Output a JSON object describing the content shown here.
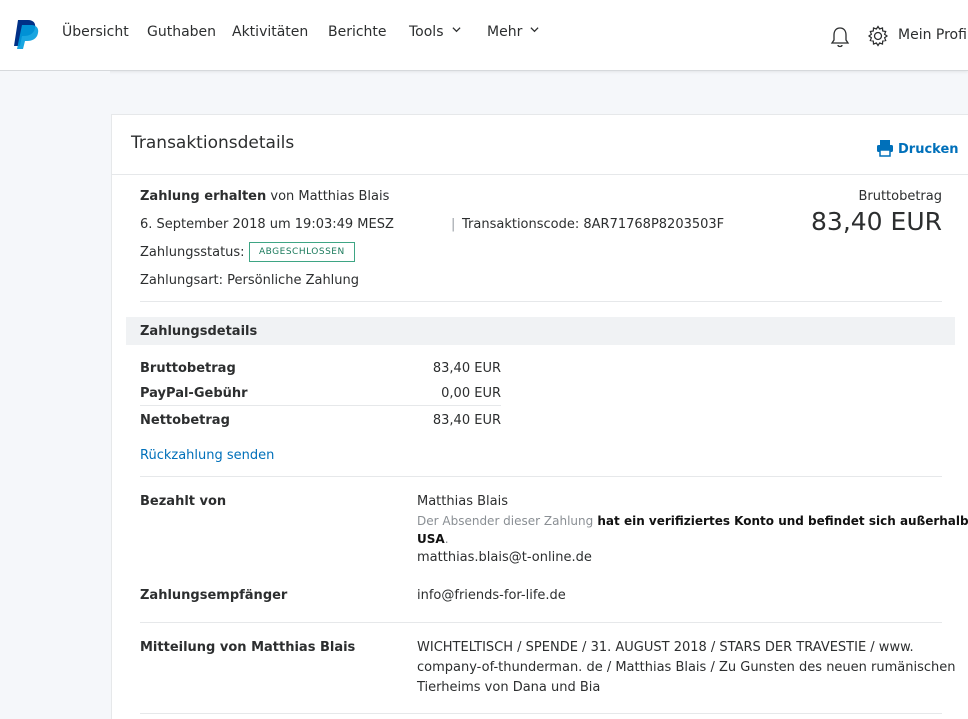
{
  "nav": {
    "items": [
      "Übersicht",
      "Guthaben",
      "Aktivitäten",
      "Berichte",
      "Tools",
      "Mehr"
    ],
    "profile": "Mein Profil"
  },
  "card": {
    "title": "Transaktionsdetails",
    "print": "Drucken"
  },
  "summary": {
    "received_label": "Zahlung erhalten",
    "from_text": "von Matthias Blais",
    "datetime": "6. September 2018 um 19:03:49 MESZ",
    "txn_code": "Transaktionscode: 8AR71768P8203503F",
    "status_label": "Zahlungsstatus:",
    "status_badge": "ABGESCHLOSSEN",
    "payment_type": "Zahlungsart: Persönliche Zahlung",
    "gross_label": "Bruttobetrag",
    "gross_amount": "83,40 EUR"
  },
  "details": {
    "heading": "Zahlungsdetails",
    "rows": [
      {
        "label": "Bruttobetrag",
        "value": "83,40 EUR"
      },
      {
        "label": "PayPal-Gebühr",
        "value": "0,00 EUR"
      },
      {
        "label": "Nettobetrag",
        "value": "83,40 EUR"
      }
    ],
    "refund_link": "Rückzahlung senden"
  },
  "payer": {
    "label": "Bezahlt von",
    "name": "Matthias Blais",
    "note_muted": "Der Absender dieser Zahlung",
    "note_bold_1": "hat ein verifiziertes Konto und befindet sich außerhalb der",
    "note_bold_2": "USA",
    "email": "matthias.blais@t-online.de"
  },
  "recipient": {
    "label": "Zahlungsempfänger",
    "email": "info@friends-for-life.de"
  },
  "message": {
    "label": "Mitteilung von Matthias Blais",
    "line1": "WICHTELTISCH / SPENDE / 31. AUGUST 2018 / STARS DER TRAVESTIE / www.",
    "line2": "company-of-thunderman. de / Matthias Blais / Zu Gunsten des neuen rumänischen",
    "line3": "Tierheims von Dana und Bia"
  },
  "colors": {
    "accent": "#0070ba",
    "badge": "#3ea584",
    "logo_dark": "#003087",
    "logo_light": "#009cde"
  }
}
